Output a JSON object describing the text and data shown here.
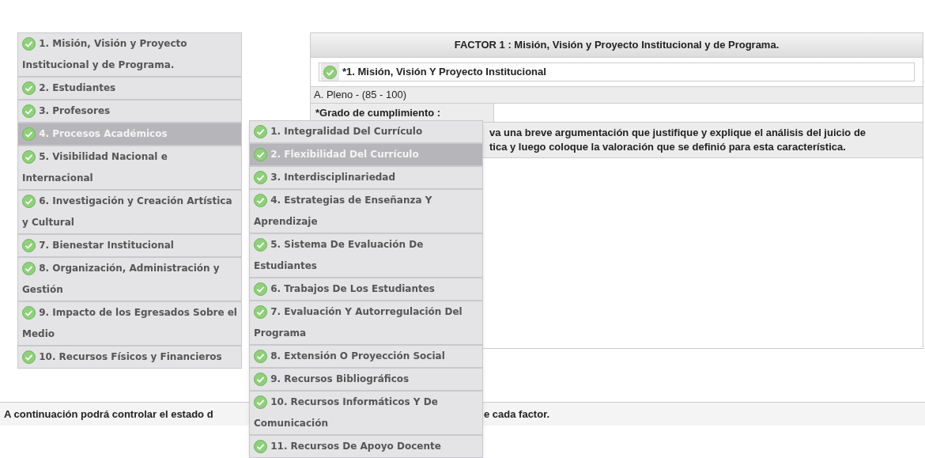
{
  "sidebar": {
    "items": [
      {
        "label": "1. Misión, Visión y Proyecto Institucional y de Programa.",
        "selected": false,
        "done": true
      },
      {
        "label": "2. Estudiantes",
        "selected": false,
        "done": true
      },
      {
        "label": "3. Profesores",
        "selected": false,
        "done": true
      },
      {
        "label": "4. Procesos Académicos",
        "selected": true,
        "done": true
      },
      {
        "label": "5. Visibilidad Nacional e Internacional",
        "selected": false,
        "done": true
      },
      {
        "label": "6. Investigación y Creación Artística y Cultural",
        "selected": false,
        "done": true
      },
      {
        "label": "7. Bienestar Institucional",
        "selected": false,
        "done": true
      },
      {
        "label": "8. Organización, Administración y Gestión",
        "selected": false,
        "done": true
      },
      {
        "label": "9. Impacto de los Egresados Sobre el Medio",
        "selected": false,
        "done": true
      },
      {
        "label": "10. Recursos Físicos y Financieros",
        "selected": false,
        "done": true
      }
    ]
  },
  "submenu": {
    "items": [
      {
        "label": "1. Integralidad Del Currículo",
        "selected": false,
        "done": true
      },
      {
        "label": "2. Flexibilidad Del Currículo",
        "selected": true,
        "done": true
      },
      {
        "label": "3. Interdisciplinariedad",
        "selected": false,
        "done": true
      },
      {
        "label": "4. Estrategias de Enseñanza Y Aprendizaje",
        "selected": false,
        "done": true
      },
      {
        "label": "5. Sistema De Evaluación De Estudiantes",
        "selected": false,
        "done": true
      },
      {
        "label": "6. Trabajos De Los Estudiantes",
        "selected": false,
        "done": true
      },
      {
        "label": "7. Evaluación Y Autorregulación Del Programa",
        "selected": false,
        "done": true
      },
      {
        "label": "8. Extensión O Proyección Social",
        "selected": false,
        "done": true
      },
      {
        "label": "9. Recursos Bibliográficos",
        "selected": false,
        "done": true
      },
      {
        "label": "10. Recursos Informáticos Y De Comunicación",
        "selected": false,
        "done": true
      },
      {
        "label": "11. Recursos De Apoyo Docente",
        "selected": false,
        "done": true
      }
    ]
  },
  "factor_panel": {
    "title": "FACTOR 1 : Misión, Visión y Proyecto Institucional y de Programa.",
    "characteristic": {
      "label": "*1. Misión, Visión Y Proyecto Institucional",
      "done": true
    },
    "level_range": "A. Pleno - (85 - 100)",
    "compliance_label": "*Grado de cumplimiento :",
    "instructions": [
      "va una breve argumentación que justifique y explique el análisis del juicio de",
      "tica y luego coloque la valoración que se definió para esta característica."
    ]
  },
  "footer": {
    "text_left": "A continuación podrá controlar el estado d",
    "text_right": "e cada factor."
  }
}
